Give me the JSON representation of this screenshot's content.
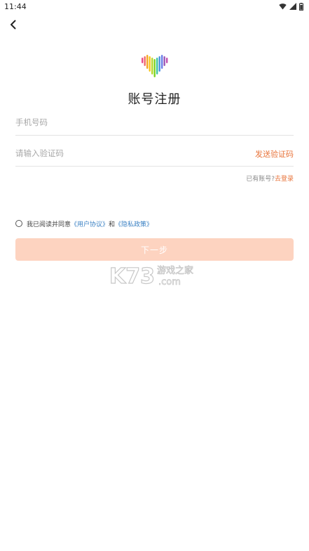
{
  "status_bar": {
    "time": "11:44",
    "icons": [
      "wifi-icon",
      "cellular-signal-icon",
      "battery-icon"
    ]
  },
  "header": {
    "back_icon": "back-arrow-icon"
  },
  "logo": {
    "icon": "rainbow-heart-logo",
    "colors": [
      "#e94b8a",
      "#f5a623",
      "#f8e71c",
      "#7ed321",
      "#4a90e2",
      "#9b59b6"
    ]
  },
  "title": "账号注册",
  "form": {
    "phone_placeholder": "手机号码",
    "code_placeholder": "请输入验证码",
    "send_code_label": "发送验证码"
  },
  "login": {
    "prompt": "已有账号?",
    "link_label": "去登录"
  },
  "agreement": {
    "prefix": "我已阅读并同意",
    "user_agreement": "《用户协议》",
    "conjunction": "和",
    "privacy_policy": "《隐私政策》",
    "checked": false
  },
  "next_button": {
    "label": "下一步"
  },
  "watermark": {
    "brand": "K73",
    "cn_text": "游戏之家",
    "suffix": ".com"
  },
  "colors": {
    "accent": "#e8743b",
    "link_blue": "#3c82c4",
    "button_disabled": "#fdd3c0",
    "divider": "#e3e3e3"
  }
}
